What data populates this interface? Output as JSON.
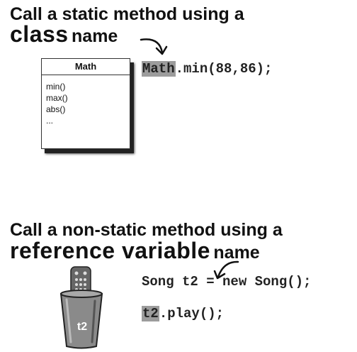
{
  "static_section": {
    "heading_line1": "Call a static method using a",
    "heading_big": "class",
    "heading_name": "name",
    "uml": {
      "title": "Math",
      "operations": [
        "min()",
        "max()",
        "abs()",
        "..."
      ]
    },
    "code": {
      "highlight": "Math",
      "rest": ".min(88,86);"
    }
  },
  "nonstatic_section": {
    "heading_line1": "Call a non-static method using a",
    "heading_big": "reference variable",
    "heading_name": "name",
    "cup_label": "t2",
    "code_line1": "Song t2 = new Song();",
    "code_line2": {
      "highlight": "t2",
      "rest": ".play();"
    }
  },
  "colors": {
    "highlight": "#9c9c9c",
    "text": "#111111"
  }
}
